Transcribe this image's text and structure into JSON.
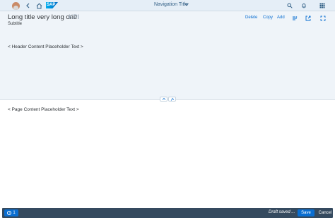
{
  "shell": {
    "nav_title": "Navigation Title",
    "logo_text": "SAP",
    "icons": [
      "avatar",
      "back-icon",
      "home-icon",
      "search-icon",
      "notifications-icon",
      "grid-icon"
    ]
  },
  "header": {
    "title": "Long title very long one",
    "kpi": "KPI",
    "subtitle": "Subtitle",
    "actions": {
      "delete": "Delete",
      "copy": "Copy",
      "add": "Add"
    },
    "header_content": "< Header Content Placeholder Text >"
  },
  "page": {
    "content": "< Page Content Placeholder Text >"
  },
  "footer": {
    "message_count": "1",
    "draft_status": "Draft saved ...",
    "save_label": "Save",
    "cancel_label": "Cancel"
  },
  "colors": {
    "shell_bg": "#e5eef7",
    "header_bg": "#eff4f9",
    "accent": "#0a6ed1",
    "footer_bg": "#354a5f"
  }
}
